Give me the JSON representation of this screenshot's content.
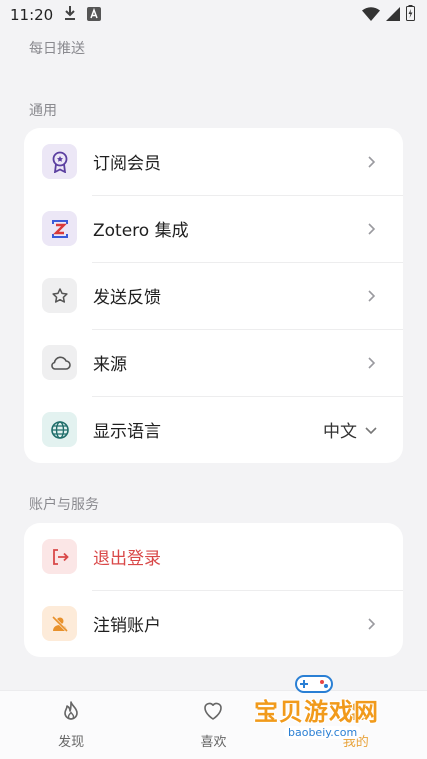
{
  "status_bar": {
    "time": "11:20",
    "icons": [
      "download-icon",
      "a-icon",
      "wifi-icon",
      "signal-icon",
      "battery-icon"
    ]
  },
  "sections": {
    "daily": {
      "title": "每日推送"
    },
    "general": {
      "title": "通用",
      "items": [
        {
          "label": "订阅会员",
          "icon": "membership-badge-icon"
        },
        {
          "label": "Zotero 集成",
          "icon": "zotero-icon"
        },
        {
          "label": "发送反馈",
          "icon": "star-icon"
        },
        {
          "label": "来源",
          "icon": "cloud-icon"
        },
        {
          "label": "显示语言",
          "icon": "globe-icon",
          "value": "中文"
        }
      ]
    },
    "account": {
      "title": "账户与服务",
      "items": [
        {
          "label": "退出登录",
          "icon": "logout-icon"
        },
        {
          "label": "注销账户",
          "icon": "delete-account-icon"
        }
      ]
    }
  },
  "bottom_nav": {
    "items": [
      {
        "label": "发现",
        "icon": "flame-icon"
      },
      {
        "label": "喜欢",
        "icon": "heart-icon"
      },
      {
        "label": "我的",
        "icon": "profile-icon"
      }
    ]
  },
  "watermark": {
    "text": "宝贝游戏网",
    "url": "baobeiy.com"
  },
  "colors": {
    "background": "#f3f3f5",
    "danger": "#d94848",
    "accent": "#e8a33b",
    "membership_icon_bg": "#ece7f6",
    "zotero_icon_bg": "#ece7f6",
    "globe_icon_bg": "#e3f2f0",
    "logout_icon_bg": "#fbe6e6",
    "delete_icon_bg": "#fdebd9"
  }
}
